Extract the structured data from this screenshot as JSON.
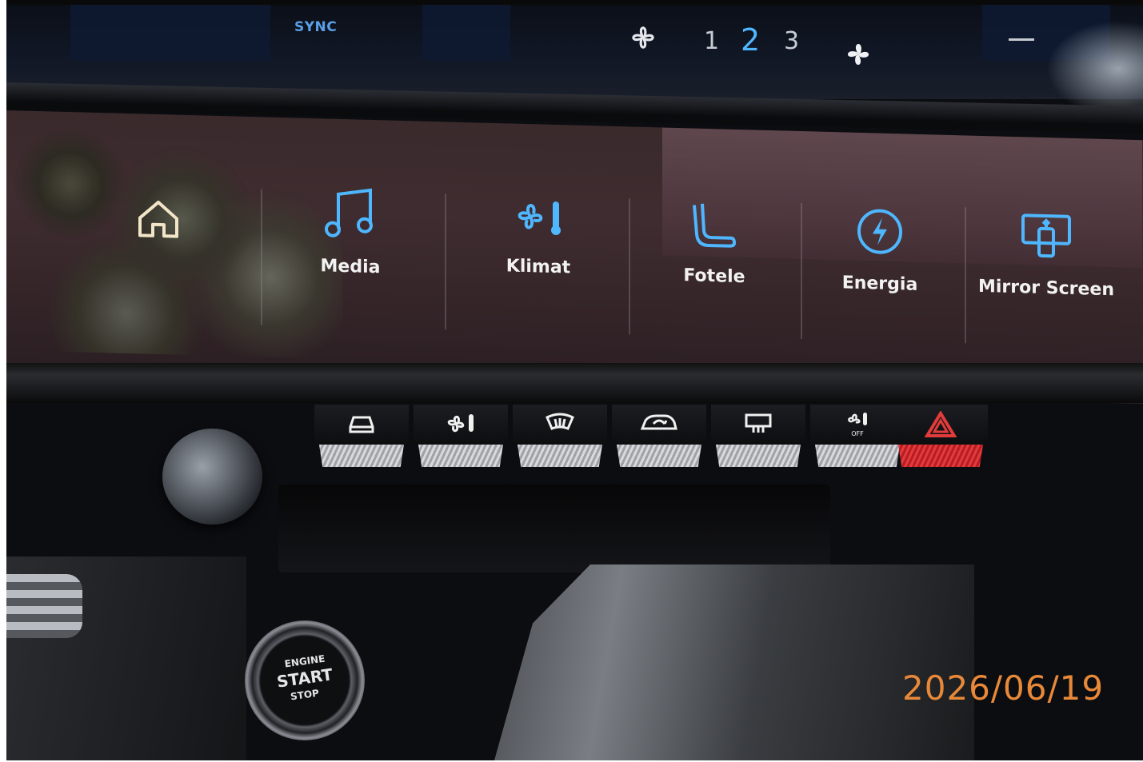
{
  "upper_display": {
    "sync_label": "SYNC",
    "fan_speeds": [
      "1",
      "2",
      "3"
    ],
    "active_fan_speed": "2",
    "minus_symbol": "—"
  },
  "menu_tiles": [
    {
      "icon": "home-icon",
      "label": ""
    },
    {
      "icon": "music-note-icon",
      "label": "Media"
    },
    {
      "icon": "fan-thermometer-icon",
      "label": "Klimat"
    },
    {
      "icon": "seat-icon",
      "label": "Fotele"
    },
    {
      "icon": "lightning-icon",
      "label": "Energia"
    },
    {
      "icon": "mirror-screen-icon",
      "label": "Mirror Screen"
    }
  ],
  "hardware_buttons": [
    {
      "icon": "car-icon"
    },
    {
      "icon": "fan-temp-icon"
    },
    {
      "icon": "front-defrost-icon"
    },
    {
      "icon": "air-recirculation-icon"
    },
    {
      "icon": "rear-defrost-icon"
    },
    {
      "icon": "climate-off-icon",
      "label": "OFF"
    },
    {
      "icon": "hazard-icon"
    }
  ],
  "start_button": {
    "line1": "ENGINE",
    "line2": "START",
    "line3": "STOP"
  },
  "date_stamp": "2026/06/19",
  "colors": {
    "accent_blue": "#4fb7ff",
    "hazard_red": "#e23b3b",
    "date_orange": "#e8893a"
  }
}
